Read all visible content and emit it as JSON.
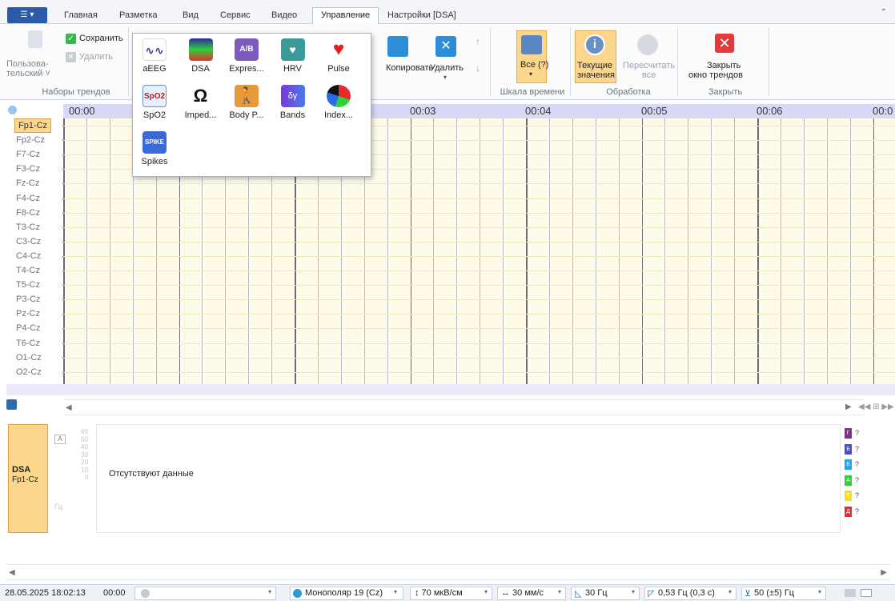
{
  "tabs": {
    "app_menu": "☰",
    "items": [
      "Главная",
      "Разметка",
      "Вид",
      "Сервис",
      "Видео",
      "Управление",
      "Настройки [DSA]"
    ],
    "active": "Управление",
    "collapse": "⌃"
  },
  "ribbon": {
    "trend_sets": {
      "user_label_line1": "Пользова-",
      "user_label_line2": "тельский ˅",
      "save": "Сохранить",
      "delete": "Удалить",
      "group": "Наборы трендов"
    },
    "trend_actions": {
      "copy": "Копировать",
      "delete": "Удалить",
      "delete_drop": "▾",
      "up": "↑",
      "down": "↓"
    },
    "time_scale": {
      "all": "Все (?)",
      "drop": "▾",
      "group": "Шкала времени"
    },
    "processing": {
      "current_line1": "Текущие",
      "current_line2": "значения",
      "recalc_line1": "Пересчитать",
      "recalc_line2": "все",
      "group": "Обработка"
    },
    "close": {
      "label_line1": "Закрыть",
      "label_line2": "окно трендов",
      "group": "Закрыть"
    }
  },
  "popup": {
    "rows": [
      [
        {
          "label": "aEEG",
          "icon": "aeeg-icon"
        },
        {
          "label": "DSA",
          "icon": "dsa-icon"
        },
        {
          "label": "Expres...",
          "icon": "express-icon"
        },
        {
          "label": "HRV",
          "icon": "hrv-icon"
        },
        {
          "label": "Pulse",
          "icon": "pulse-icon"
        }
      ],
      [
        {
          "label": "SpO2",
          "icon": "spo2-icon"
        },
        {
          "label": "Imped...",
          "icon": "impedance-icon"
        },
        {
          "label": "Body P...",
          "icon": "body-position-icon"
        },
        {
          "label": "Bands",
          "icon": "bands-icon"
        },
        {
          "label": "Index...",
          "icon": "index-icon"
        }
      ],
      [
        {
          "label": "Spikes",
          "icon": "spikes-icon"
        }
      ]
    ],
    "icon_text": {
      "spo2": "SpO2",
      "spikes": "SPIKE",
      "imped": "Ω",
      "bands": "δγ",
      "express": "A/B"
    }
  },
  "timeline": {
    "labels": [
      "00:00",
      "00:03",
      "00:04",
      "00:05",
      "00:06",
      "00:0"
    ]
  },
  "channels": [
    "Fp1-Cz",
    "Fp2-Cz",
    "F7-Cz",
    "F3-Cz",
    "Fz-Cz",
    "F4-Cz",
    "F8-Cz",
    "T3-Cz",
    "C3-Cz",
    "C4-Cz",
    "T4-Cz",
    "T5-Cz",
    "P3-Cz",
    "Pz-Cz",
    "P4-Cz",
    "T6-Cz",
    "O1-Cz",
    "O2-Cz"
  ],
  "scroll": {
    "left": "◀",
    "right": "▶",
    "nav": "◀◀  ⊞  ▶▶"
  },
  "dsa": {
    "title": "DSA",
    "channel": "Fp1-Cz",
    "freq_axis": [
      "60",
      "50",
      "40",
      "30",
      "20",
      "10",
      "0"
    ],
    "unit": "Гц",
    "no_data": "Отсутствуют данные",
    "legend": [
      {
        "letter": "Г",
        "color": "#8b2a8f",
        "value": "?"
      },
      {
        "letter": "Б",
        "color": "#4a4ad8",
        "value": "?"
      },
      {
        "letter": "Б",
        "color": "#22a7e8",
        "value": "?"
      },
      {
        "letter": "А",
        "color": "#2fd13a",
        "value": "?"
      },
      {
        "letter": "Т",
        "color": "#f2e21c",
        "value": "?"
      },
      {
        "letter": "Д",
        "color": "#e82a2a",
        "value": "?"
      }
    ]
  },
  "status": {
    "datetime": "28.05.2025 18:02:13",
    "time": "00:00",
    "montage": "Монополяр 19 (Cz)",
    "sensitivity": "↕ 70 мкВ/см",
    "speed": "↔ 30 мм/с",
    "lowpass": "30 Гц",
    "highpass": "0,53 Гц (0,3 с)",
    "notch": "50 (±5) Гц",
    "drop": "▾"
  },
  "colors": {
    "accent": "#2b5aa8",
    "highlight": "#fbd68d",
    "grid_bg": "#fffbe9",
    "timeline_bg": "#d9d9f7",
    "close_red": "#e23b3b"
  }
}
